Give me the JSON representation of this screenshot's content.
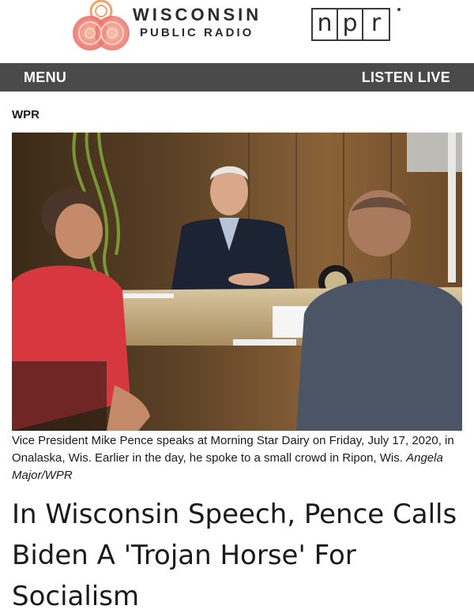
{
  "header": {
    "station_name": "WISCONSIN",
    "station_sub": "PUBLIC RADIO",
    "partner_logo": [
      "n",
      "p",
      "r"
    ]
  },
  "nav": {
    "menu_label": "MENU",
    "listen_label": "LISTEN LIVE"
  },
  "article": {
    "source": "WPR",
    "photo_alt_icon": "photo",
    "caption": "Vice President Mike Pence speaks at Morning Star Dairy on Friday, July 17, 2020, in Onalaska, Wis. Earlier in the day, he spoke to a small crowd in Ripon, Wis.",
    "credit": "Angela Major/WPR",
    "headline": "In Wisconsin Speech, Pence Calls Biden A 'Trojan Horse' For Socialism"
  },
  "colors": {
    "nav_bg": "#4a4a4a",
    "logo_accent": "#f0826a",
    "text": "#1a1a1a"
  }
}
